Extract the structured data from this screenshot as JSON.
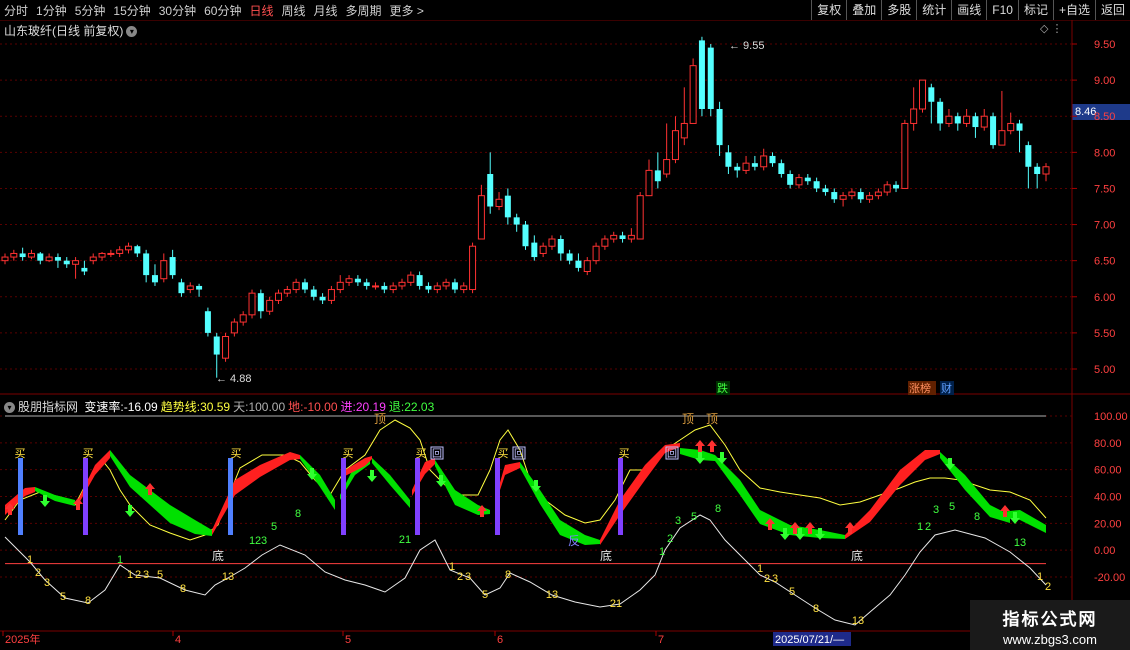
{
  "topbar": {
    "tabs": [
      "分时",
      "1分钟",
      "5分钟",
      "15分钟",
      "30分钟",
      "60分钟",
      "日线",
      "周线",
      "月线",
      "多周期",
      "更多 >"
    ],
    "active_index": 6,
    "tools": [
      "复权",
      "叠加",
      "多股",
      "统计",
      "画线",
      "F10",
      "标记",
      "+自选",
      "返回"
    ]
  },
  "stock": {
    "title": "山东玻纤(日线 前复权)",
    "current_price": "8.46",
    "high_mark": "9.55",
    "low_mark": "4.88"
  },
  "price_axis": [
    "9.50",
    "9.00",
    "8.50",
    "8.00",
    "7.50",
    "7.00",
    "6.50",
    "6.00",
    "5.50",
    "5.00"
  ],
  "indicator": {
    "name": "股朋指标网",
    "items": [
      {
        "label": "变速率:",
        "value": "-16.09",
        "color": "#ffffff"
      },
      {
        "label": "趋势线:",
        "value": "30.59",
        "color": "#ffff40"
      },
      {
        "label": "天:",
        "value": "100.00",
        "color": "#b0b0b0"
      },
      {
        "label": "地:",
        "value": "-10.00",
        "color": "#ff5050"
      },
      {
        "label": "进:",
        "value": "20.19",
        "color": "#ff40ff"
      },
      {
        "label": "退:",
        "value": "22.03",
        "color": "#40ff40"
      }
    ],
    "axis": [
      "100.00",
      "80.00",
      "60.00",
      "40.00",
      "20.00",
      "0.00",
      "-20.00"
    ]
  },
  "badges": {
    "fall": "跌",
    "limit": "涨榜",
    "fin": "财"
  },
  "labels": {
    "buy": "买",
    "back": "回",
    "bottom": "底",
    "top": "顶",
    "reverse": "反",
    "nums": [
      "1",
      "2",
      "3",
      "5",
      "8",
      "13",
      "21"
    ]
  },
  "time_axis": [
    "2025年",
    "4",
    "5",
    "6",
    "7",
    "2025/07/21/—"
  ],
  "watermark": {
    "line1": "指标公式网",
    "line2": "www.zbgs3.com"
  },
  "colors": {
    "up": "#ff3232",
    "down": "#54ffff",
    "green_band": "#00e000",
    "red_band": "#ff2020",
    "grid": "#5a0000"
  },
  "candle_data": [
    [
      6.5,
      6.55,
      6.6,
      6.45
    ],
    [
      6.55,
      6.6,
      6.65,
      6.5
    ],
    [
      6.6,
      6.55,
      6.68,
      6.5
    ],
    [
      6.55,
      6.6,
      6.65,
      6.52
    ],
    [
      6.6,
      6.5,
      6.62,
      6.45
    ],
    [
      6.5,
      6.55,
      6.6,
      6.48
    ],
    [
      6.55,
      6.5,
      6.6,
      6.4
    ],
    [
      6.5,
      6.45,
      6.55,
      6.4
    ],
    [
      6.45,
      6.5,
      6.55,
      6.25
    ],
    [
      6.4,
      6.35,
      6.5,
      6.3
    ],
    [
      6.5,
      6.55,
      6.6,
      6.45
    ],
    [
      6.55,
      6.6,
      6.62,
      6.5
    ],
    [
      6.6,
      6.6,
      6.65,
      6.55
    ],
    [
      6.6,
      6.65,
      6.7,
      6.55
    ],
    [
      6.65,
      6.7,
      6.75,
      6.6
    ],
    [
      6.7,
      6.6,
      6.72,
      6.55
    ],
    [
      6.6,
      6.3,
      6.65,
      6.2
    ],
    [
      6.3,
      6.2,
      6.45,
      6.15
    ],
    [
      6.25,
      6.5,
      6.6,
      6.2
    ],
    [
      6.55,
      6.3,
      6.65,
      6.25
    ],
    [
      6.2,
      6.05,
      6.25,
      6.0
    ],
    [
      6.1,
      6.15,
      6.2,
      6.05
    ],
    [
      6.15,
      6.1,
      6.18,
      6.0
    ],
    [
      5.8,
      5.5,
      5.85,
      5.45
    ],
    [
      5.45,
      5.2,
      5.5,
      4.88
    ],
    [
      5.15,
      5.45,
      5.5,
      5.1
    ],
    [
      5.5,
      5.65,
      5.7,
      5.45
    ],
    [
      5.65,
      5.75,
      5.8,
      5.6
    ],
    [
      5.75,
      6.05,
      6.1,
      5.7
    ],
    [
      6.05,
      5.8,
      6.1,
      5.7
    ],
    [
      5.8,
      5.95,
      6.0,
      5.75
    ],
    [
      5.95,
      6.05,
      6.1,
      5.9
    ],
    [
      6.05,
      6.1,
      6.15,
      6.0
    ],
    [
      6.1,
      6.2,
      6.25,
      6.05
    ],
    [
      6.2,
      6.1,
      6.25,
      6.05
    ],
    [
      6.1,
      6.0,
      6.15,
      5.95
    ],
    [
      6.0,
      5.95,
      6.05,
      5.9
    ],
    [
      5.95,
      6.1,
      6.15,
      5.9
    ],
    [
      6.1,
      6.2,
      6.3,
      6.05
    ],
    [
      6.2,
      6.25,
      6.3,
      6.15
    ],
    [
      6.25,
      6.2,
      6.3,
      6.15
    ],
    [
      6.2,
      6.15,
      6.25,
      6.1
    ],
    [
      6.15,
      6.15,
      6.2,
      6.1
    ],
    [
      6.15,
      6.1,
      6.2,
      6.05
    ],
    [
      6.1,
      6.15,
      6.2,
      6.05
    ],
    [
      6.15,
      6.2,
      6.25,
      6.1
    ],
    [
      6.2,
      6.3,
      6.35,
      6.15
    ],
    [
      6.3,
      6.15,
      6.35,
      6.1
    ],
    [
      6.15,
      6.1,
      6.2,
      6.05
    ],
    [
      6.1,
      6.15,
      6.2,
      6.05
    ],
    [
      6.15,
      6.2,
      6.25,
      6.1
    ],
    [
      6.2,
      6.1,
      6.25,
      6.05
    ],
    [
      6.1,
      6.15,
      6.2,
      6.05
    ],
    [
      6.1,
      6.7,
      6.75,
      6.05
    ],
    [
      6.8,
      7.4,
      7.55,
      6.8
    ],
    [
      7.7,
      7.25,
      8.0,
      7.15
    ],
    [
      7.25,
      7.35,
      7.45,
      7.2
    ],
    [
      7.4,
      7.1,
      7.5,
      7.0
    ],
    [
      7.1,
      7.0,
      7.15,
      6.9
    ],
    [
      7.0,
      6.7,
      7.05,
      6.65
    ],
    [
      6.75,
      6.55,
      6.85,
      6.5
    ],
    [
      6.6,
      6.7,
      6.75,
      6.55
    ],
    [
      6.7,
      6.8,
      6.85,
      6.65
    ],
    [
      6.8,
      6.6,
      6.85,
      6.5
    ],
    [
      6.6,
      6.5,
      6.65,
      6.45
    ],
    [
      6.5,
      6.4,
      6.6,
      6.35
    ],
    [
      6.35,
      6.5,
      6.55,
      6.3
    ],
    [
      6.5,
      6.7,
      6.75,
      6.45
    ],
    [
      6.7,
      6.8,
      6.85,
      6.65
    ],
    [
      6.8,
      6.85,
      6.9,
      6.75
    ],
    [
      6.85,
      6.8,
      6.9,
      6.75
    ],
    [
      6.8,
      6.85,
      6.95,
      6.75
    ],
    [
      6.8,
      7.4,
      7.45,
      6.8
    ],
    [
      7.4,
      7.75,
      7.9,
      7.4
    ],
    [
      7.75,
      7.6,
      8.0,
      7.5
    ],
    [
      7.7,
      7.9,
      8.4,
      7.65
    ],
    [
      7.9,
      8.3,
      8.5,
      7.85
    ],
    [
      8.2,
      8.4,
      8.9,
      8.1
    ],
    [
      8.4,
      9.2,
      9.3,
      8.4
    ],
    [
      9.55,
      8.6,
      9.6,
      8.5
    ],
    [
      9.45,
      8.6,
      9.5,
      8.5
    ],
    [
      8.6,
      8.1,
      8.7,
      7.95
    ],
    [
      8.0,
      7.8,
      8.1,
      7.7
    ],
    [
      7.8,
      7.75,
      7.85,
      7.65
    ],
    [
      7.75,
      7.85,
      7.95,
      7.7
    ],
    [
      7.85,
      7.8,
      7.95,
      7.75
    ],
    [
      7.8,
      7.95,
      8.05,
      7.75
    ],
    [
      7.95,
      7.85,
      8.0,
      7.8
    ],
    [
      7.85,
      7.7,
      7.9,
      7.65
    ],
    [
      7.7,
      7.55,
      7.75,
      7.5
    ],
    [
      7.55,
      7.65,
      7.7,
      7.5
    ],
    [
      7.65,
      7.6,
      7.7,
      7.55
    ],
    [
      7.6,
      7.5,
      7.65,
      7.45
    ],
    [
      7.5,
      7.45,
      7.55,
      7.4
    ],
    [
      7.45,
      7.35,
      7.5,
      7.3
    ],
    [
      7.35,
      7.4,
      7.45,
      7.25
    ],
    [
      7.4,
      7.45,
      7.5,
      7.35
    ],
    [
      7.45,
      7.35,
      7.5,
      7.3
    ],
    [
      7.35,
      7.4,
      7.45,
      7.3
    ],
    [
      7.4,
      7.45,
      7.5,
      7.35
    ],
    [
      7.45,
      7.55,
      7.6,
      7.4
    ],
    [
      7.55,
      7.5,
      7.6,
      7.45
    ],
    [
      7.5,
      8.4,
      8.45,
      7.5
    ],
    [
      8.4,
      8.6,
      8.9,
      8.3
    ],
    [
      8.6,
      9.0,
      9.0,
      8.55
    ],
    [
      8.9,
      8.7,
      8.95,
      8.4
    ],
    [
      8.7,
      8.4,
      8.75,
      8.3
    ],
    [
      8.4,
      8.5,
      8.6,
      8.35
    ],
    [
      8.5,
      8.4,
      8.55,
      8.3
    ],
    [
      8.4,
      8.5,
      8.6,
      8.35
    ],
    [
      8.5,
      8.35,
      8.55,
      8.2
    ],
    [
      8.35,
      8.5,
      8.6,
      8.3
    ],
    [
      8.5,
      8.1,
      8.55,
      8.05
    ],
    [
      8.1,
      8.3,
      8.85,
      8.1
    ],
    [
      8.3,
      8.4,
      8.55,
      8.25
    ],
    [
      8.4,
      8.3,
      8.45,
      8.0
    ],
    [
      8.1,
      7.8,
      8.15,
      7.5
    ],
    [
      7.8,
      7.7,
      7.85,
      7.5
    ],
    [
      7.7,
      7.8,
      7.85,
      7.6
    ]
  ]
}
